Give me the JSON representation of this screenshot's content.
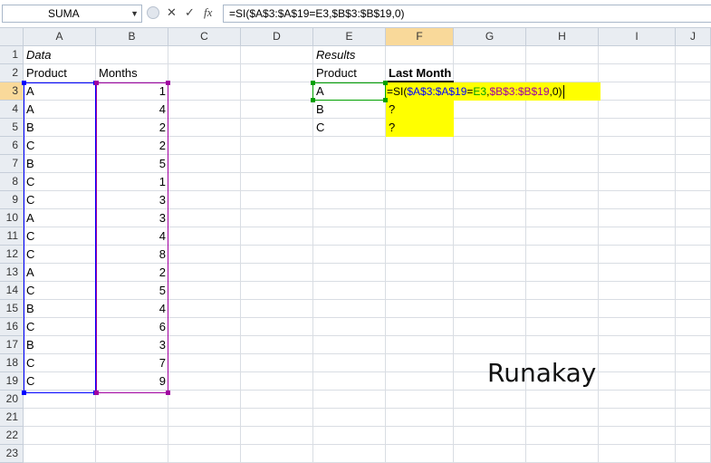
{
  "formula_bar": {
    "name_box": "SUMA",
    "cancel_icon": "✕",
    "enter_icon": "✓",
    "fx_label": "fx",
    "formula": "=SI($A$3:$A$19=E3,$B$3:$B$19,0)"
  },
  "columns": [
    "A",
    "B",
    "C",
    "D",
    "E",
    "F",
    "G",
    "H",
    "I",
    "J"
  ],
  "rows": [
    "1",
    "2",
    "3",
    "4",
    "5",
    "6",
    "7",
    "8",
    "9",
    "10",
    "11",
    "12",
    "13",
    "14",
    "15",
    "16",
    "17",
    "18",
    "19",
    "20",
    "21",
    "22",
    "23"
  ],
  "data": {
    "title": "Data",
    "product_header": "Product",
    "months_header": "Months",
    "products": [
      "A",
      "A",
      "B",
      "C",
      "B",
      "C",
      "C",
      "A",
      "C",
      "C",
      "A",
      "C",
      "B",
      "C",
      "B",
      "C",
      "C"
    ],
    "months": [
      "1",
      "4",
      "2",
      "2",
      "5",
      "1",
      "3",
      "3",
      "4",
      "8",
      "2",
      "5",
      "4",
      "6",
      "3",
      "7",
      "9"
    ]
  },
  "results": {
    "title": "Results",
    "product_header": "Product",
    "last_month_header": "Last Month",
    "products": [
      "A",
      "B",
      "C"
    ],
    "edit_formula": {
      "prefix": "=SI(",
      "ref1": "$A$3:$A$19",
      "eq": "=",
      "ref2": "E3",
      "comma": ",",
      "ref3": "$B$3:$B$19",
      "suffix": ",0)"
    },
    "placeholders": [
      "?",
      "?"
    ]
  },
  "watermark": "Runakay",
  "colors": {
    "ref_blue": "#0000ff",
    "ref_green": "#00a000",
    "ref_purple": "#a000a0",
    "highlight": "#ffff00"
  }
}
